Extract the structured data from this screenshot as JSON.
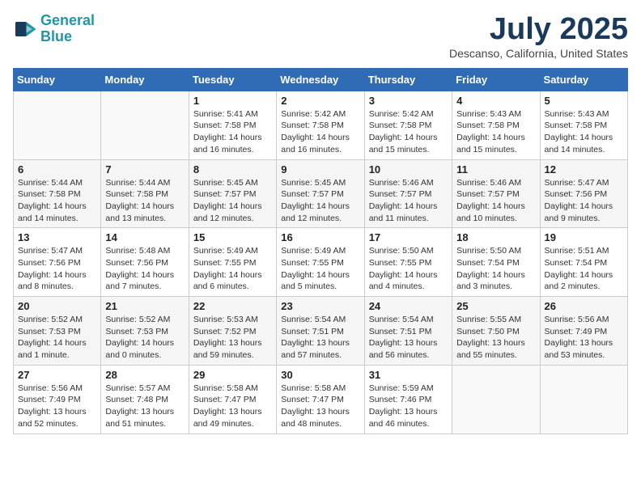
{
  "header": {
    "logo_line1": "General",
    "logo_line2": "Blue",
    "month": "July 2025",
    "location": "Descanso, California, United States"
  },
  "weekdays": [
    "Sunday",
    "Monday",
    "Tuesday",
    "Wednesday",
    "Thursday",
    "Friday",
    "Saturday"
  ],
  "weeks": [
    [
      {
        "day": "",
        "info": ""
      },
      {
        "day": "",
        "info": ""
      },
      {
        "day": "1",
        "info": "Sunrise: 5:41 AM\nSunset: 7:58 PM\nDaylight: 14 hours and 16 minutes."
      },
      {
        "day": "2",
        "info": "Sunrise: 5:42 AM\nSunset: 7:58 PM\nDaylight: 14 hours and 16 minutes."
      },
      {
        "day": "3",
        "info": "Sunrise: 5:42 AM\nSunset: 7:58 PM\nDaylight: 14 hours and 15 minutes."
      },
      {
        "day": "4",
        "info": "Sunrise: 5:43 AM\nSunset: 7:58 PM\nDaylight: 14 hours and 15 minutes."
      },
      {
        "day": "5",
        "info": "Sunrise: 5:43 AM\nSunset: 7:58 PM\nDaylight: 14 hours and 14 minutes."
      }
    ],
    [
      {
        "day": "6",
        "info": "Sunrise: 5:44 AM\nSunset: 7:58 PM\nDaylight: 14 hours and 14 minutes."
      },
      {
        "day": "7",
        "info": "Sunrise: 5:44 AM\nSunset: 7:58 PM\nDaylight: 14 hours and 13 minutes."
      },
      {
        "day": "8",
        "info": "Sunrise: 5:45 AM\nSunset: 7:57 PM\nDaylight: 14 hours and 12 minutes."
      },
      {
        "day": "9",
        "info": "Sunrise: 5:45 AM\nSunset: 7:57 PM\nDaylight: 14 hours and 12 minutes."
      },
      {
        "day": "10",
        "info": "Sunrise: 5:46 AM\nSunset: 7:57 PM\nDaylight: 14 hours and 11 minutes."
      },
      {
        "day": "11",
        "info": "Sunrise: 5:46 AM\nSunset: 7:57 PM\nDaylight: 14 hours and 10 minutes."
      },
      {
        "day": "12",
        "info": "Sunrise: 5:47 AM\nSunset: 7:56 PM\nDaylight: 14 hours and 9 minutes."
      }
    ],
    [
      {
        "day": "13",
        "info": "Sunrise: 5:47 AM\nSunset: 7:56 PM\nDaylight: 14 hours and 8 minutes."
      },
      {
        "day": "14",
        "info": "Sunrise: 5:48 AM\nSunset: 7:56 PM\nDaylight: 14 hours and 7 minutes."
      },
      {
        "day": "15",
        "info": "Sunrise: 5:49 AM\nSunset: 7:55 PM\nDaylight: 14 hours and 6 minutes."
      },
      {
        "day": "16",
        "info": "Sunrise: 5:49 AM\nSunset: 7:55 PM\nDaylight: 14 hours and 5 minutes."
      },
      {
        "day": "17",
        "info": "Sunrise: 5:50 AM\nSunset: 7:55 PM\nDaylight: 14 hours and 4 minutes."
      },
      {
        "day": "18",
        "info": "Sunrise: 5:50 AM\nSunset: 7:54 PM\nDaylight: 14 hours and 3 minutes."
      },
      {
        "day": "19",
        "info": "Sunrise: 5:51 AM\nSunset: 7:54 PM\nDaylight: 14 hours and 2 minutes."
      }
    ],
    [
      {
        "day": "20",
        "info": "Sunrise: 5:52 AM\nSunset: 7:53 PM\nDaylight: 14 hours and 1 minute."
      },
      {
        "day": "21",
        "info": "Sunrise: 5:52 AM\nSunset: 7:53 PM\nDaylight: 14 hours and 0 minutes."
      },
      {
        "day": "22",
        "info": "Sunrise: 5:53 AM\nSunset: 7:52 PM\nDaylight: 13 hours and 59 minutes."
      },
      {
        "day": "23",
        "info": "Sunrise: 5:54 AM\nSunset: 7:51 PM\nDaylight: 13 hours and 57 minutes."
      },
      {
        "day": "24",
        "info": "Sunrise: 5:54 AM\nSunset: 7:51 PM\nDaylight: 13 hours and 56 minutes."
      },
      {
        "day": "25",
        "info": "Sunrise: 5:55 AM\nSunset: 7:50 PM\nDaylight: 13 hours and 55 minutes."
      },
      {
        "day": "26",
        "info": "Sunrise: 5:56 AM\nSunset: 7:49 PM\nDaylight: 13 hours and 53 minutes."
      }
    ],
    [
      {
        "day": "27",
        "info": "Sunrise: 5:56 AM\nSunset: 7:49 PM\nDaylight: 13 hours and 52 minutes."
      },
      {
        "day": "28",
        "info": "Sunrise: 5:57 AM\nSunset: 7:48 PM\nDaylight: 13 hours and 51 minutes."
      },
      {
        "day": "29",
        "info": "Sunrise: 5:58 AM\nSunset: 7:47 PM\nDaylight: 13 hours and 49 minutes."
      },
      {
        "day": "30",
        "info": "Sunrise: 5:58 AM\nSunset: 7:47 PM\nDaylight: 13 hours and 48 minutes."
      },
      {
        "day": "31",
        "info": "Sunrise: 5:59 AM\nSunset: 7:46 PM\nDaylight: 13 hours and 46 minutes."
      },
      {
        "day": "",
        "info": ""
      },
      {
        "day": "",
        "info": ""
      }
    ]
  ]
}
